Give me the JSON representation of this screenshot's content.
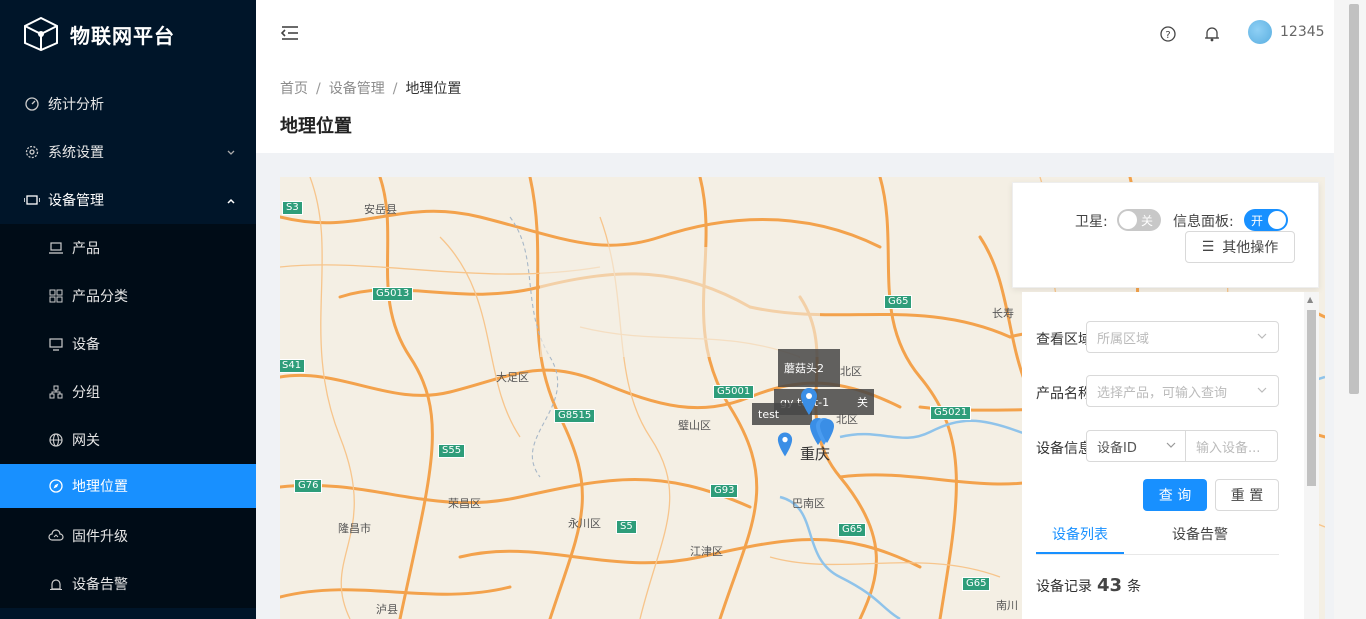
{
  "app": {
    "title": "物联网平台"
  },
  "sidebar": {
    "items": [
      {
        "label": "统计分析",
        "icon": "dashboard-icon"
      },
      {
        "label": "系统设置",
        "icon": "gear-icon"
      },
      {
        "label": "设备管理",
        "icon": "device-manage-icon"
      }
    ],
    "submenu": [
      {
        "label": "产品",
        "icon": "laptop-icon"
      },
      {
        "label": "产品分类",
        "icon": "appstore-icon"
      },
      {
        "label": "设备",
        "icon": "desktop-icon"
      },
      {
        "label": "分组",
        "icon": "cluster-icon"
      },
      {
        "label": "网关",
        "icon": "global-icon"
      },
      {
        "label": "地理位置",
        "icon": "compass-icon"
      },
      {
        "label": "固件升级",
        "icon": "cloud-upload-icon"
      },
      {
        "label": "设备告警",
        "icon": "alarm-icon"
      }
    ]
  },
  "header": {
    "username": "12345"
  },
  "breadcrumb": {
    "home": "首页",
    "section": "设备管理",
    "current": "地理位置",
    "sep": "/"
  },
  "page": {
    "title": "地理位置"
  },
  "controls": {
    "satellite_label": "卫星:",
    "satellite_state": "关",
    "info_panel_label": "信息面板:",
    "info_panel_state": "开",
    "more_ops": "其他操作"
  },
  "filter": {
    "area_label": "查看区域",
    "area_placeholder": "所属区域",
    "product_label": "产品名称",
    "product_placeholder": "选择产品，可输入查询",
    "device_label": "设备信息",
    "device_select": "设备ID",
    "device_placeholder": "输入设备...",
    "query_btn": "查 询",
    "reset_btn": "重 置"
  },
  "tabs": {
    "list": "设备列表",
    "alarm": "设备告警"
  },
  "records": {
    "prefix": "设备记录",
    "count": "43",
    "suffix": "条"
  },
  "map": {
    "popups": [
      "蘑菇头2",
      "gy test-1",
      "关",
      "test"
    ],
    "places": [
      "安岳县",
      "大足区",
      "璧山区",
      "荣昌区",
      "永川区",
      "隆昌市",
      "江津区",
      "巴南区",
      "重庆",
      "北区",
      "北区",
      "长寿",
      "泸县",
      "南川"
    ],
    "roads": [
      "S3",
      "G5013",
      "S41",
      "G5001",
      "G8515",
      "S55",
      "G76",
      "G93",
      "S5",
      "G65",
      "G65",
      "G65",
      "G5021"
    ]
  },
  "colors": {
    "accent": "#1890ff",
    "sidebar": "#001529",
    "road": "#f5a04a"
  }
}
